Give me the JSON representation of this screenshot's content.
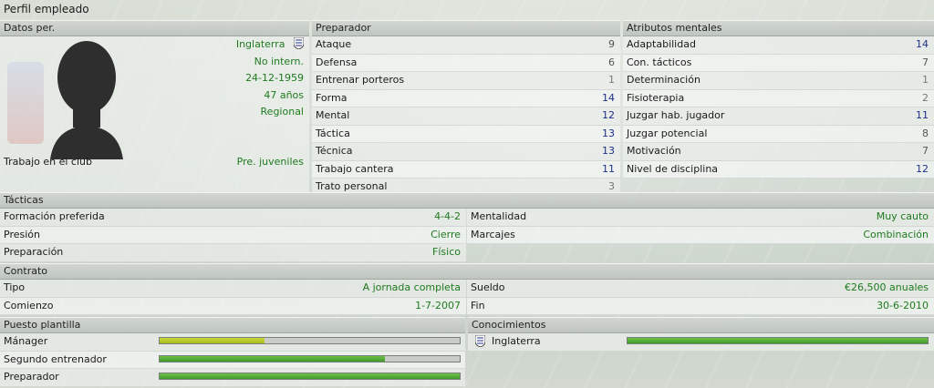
{
  "title": "Perfil empleado",
  "personal": {
    "header": "Datos per.",
    "nationality": "Inglaterra",
    "intl_status": "No intern.",
    "birthdate": "24-12-1959",
    "age": "47 años",
    "reputation": "Regional",
    "club_job_label": "Trabajo en el club",
    "club_job_value": "Pre. juveniles"
  },
  "coach": {
    "header": "Preparador",
    "rows": [
      {
        "label": "Ataque",
        "value": "9",
        "color": "gray"
      },
      {
        "label": "Defensa",
        "value": "6",
        "color": "gray"
      },
      {
        "label": "Entrenar porteros",
        "value": "1",
        "color": "graylight"
      },
      {
        "label": "Forma",
        "value": "14",
        "color": "blue"
      },
      {
        "label": "Mental",
        "value": "12",
        "color": "blue"
      },
      {
        "label": "Táctica",
        "value": "13",
        "color": "blue"
      },
      {
        "label": "Técnica",
        "value": "13",
        "color": "blue"
      },
      {
        "label": "Trabajo cantera",
        "value": "11",
        "color": "blue"
      },
      {
        "label": "Trato personal",
        "value": "3",
        "color": "graylight"
      }
    ]
  },
  "mental": {
    "header": "Atributos mentales",
    "rows": [
      {
        "label": "Adaptabilidad",
        "value": "14",
        "color": "blue"
      },
      {
        "label": "Con. tácticos",
        "value": "7",
        "color": "gray"
      },
      {
        "label": "Determinación",
        "value": "1",
        "color": "graylight"
      },
      {
        "label": "Fisioterapia",
        "value": "2",
        "color": "graylight"
      },
      {
        "label": "Juzgar hab. jugador",
        "value": "11",
        "color": "blue"
      },
      {
        "label": "Juzgar potencial",
        "value": "8",
        "color": "gray"
      },
      {
        "label": "Motivación",
        "value": "7",
        "color": "gray"
      },
      {
        "label": "Nivel de disciplina",
        "value": "12",
        "color": "blue"
      }
    ]
  },
  "tactics": {
    "header": "Tácticas",
    "formation_label": "Formación preferida",
    "formation_value": "4-4-2",
    "pressing_label": "Presión",
    "pressing_value": "Cierre",
    "preparation_label": "Preparación",
    "preparation_value": "Físico",
    "mentality_label": "Mentalidad",
    "mentality_value": "Muy cauto",
    "marking_label": "Marcajes",
    "marking_value": "Combinación"
  },
  "contract": {
    "header": "Contrato",
    "type_label": "Tipo",
    "type_value": "A jornada completa",
    "start_label": "Comienzo",
    "start_value": "1-7-2007",
    "salary_label": "Sueldo",
    "salary_value": "€26,500 anuales",
    "end_label": "Fin",
    "end_value": "30-6-2010"
  },
  "squad_role": {
    "header": "Puesto plantilla",
    "rows": [
      {
        "label": "Mánager",
        "level": 0.35,
        "color": "yellow"
      },
      {
        "label": "Segundo entrenador",
        "level": 0.75,
        "color": "green"
      },
      {
        "label": "Preparador",
        "level": 1.0,
        "color": "green"
      }
    ]
  },
  "knowledge": {
    "header": "Conocimientos",
    "rows": [
      {
        "label": "Inglaterra",
        "level": 1.0,
        "color": "green"
      }
    ]
  },
  "colors": {
    "value_green": "#1f7a1f",
    "value_blue": "#1c2f8a",
    "bar_green": "#4fae35",
    "bar_yellow": "#b8c92a"
  }
}
